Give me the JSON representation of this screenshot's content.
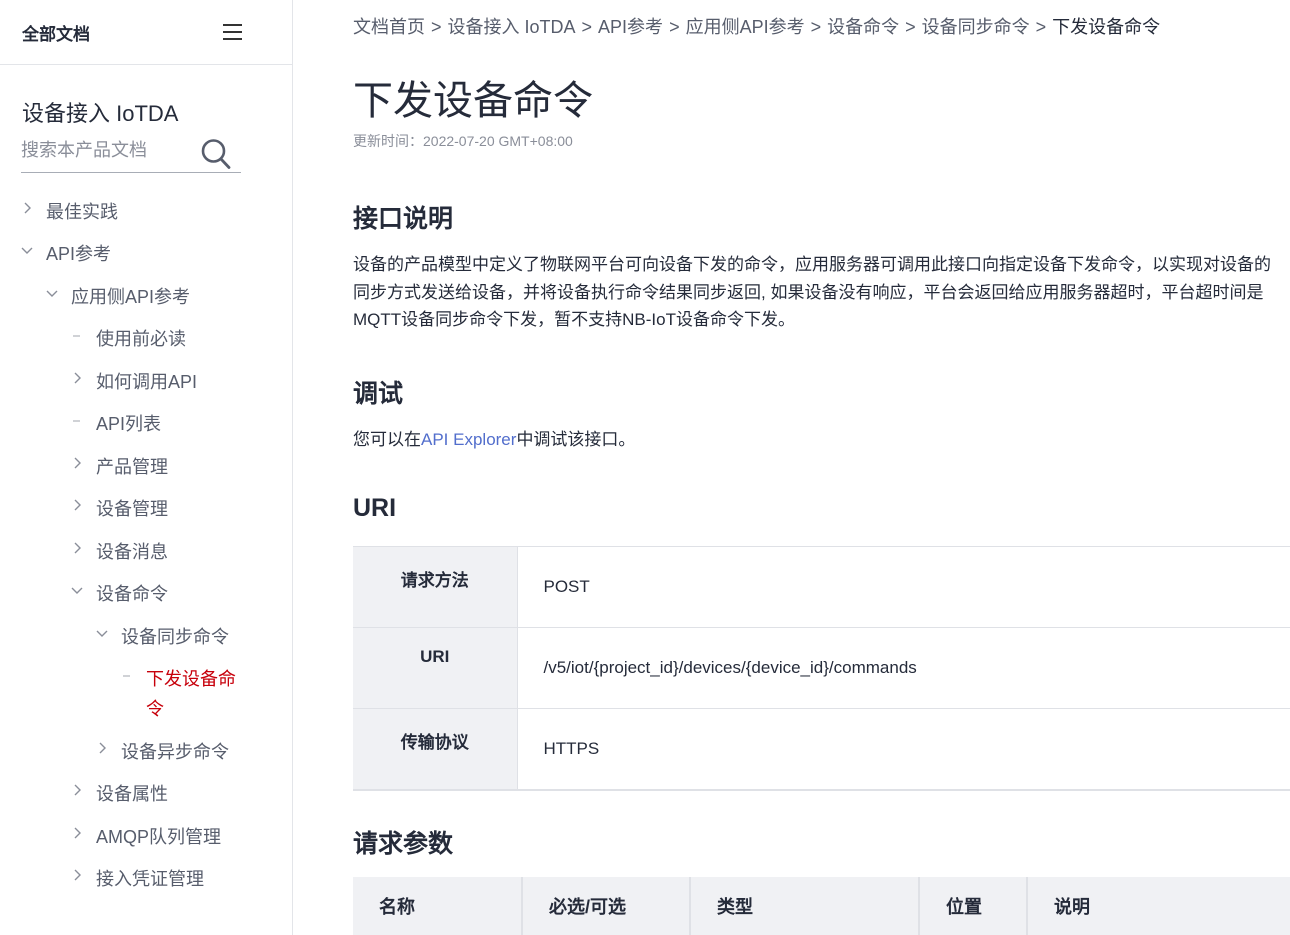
{
  "sidebar": {
    "all_docs": "全部文档",
    "product_title": "设备接入 IoTDA",
    "search_placeholder": "搜索本产品文档",
    "items": [
      {
        "label": "最佳实践",
        "marker": "chevron-right"
      },
      {
        "label": "API参考",
        "marker": "chevron-down"
      },
      {
        "label": "应用侧API参考",
        "marker": "chevron-down"
      },
      {
        "label": "使用前必读",
        "marker": "dash"
      },
      {
        "label": "如何调用API",
        "marker": "chevron-right"
      },
      {
        "label": "API列表",
        "marker": "dash"
      },
      {
        "label": "产品管理",
        "marker": "chevron-right"
      },
      {
        "label": "设备管理",
        "marker": "chevron-right"
      },
      {
        "label": "设备消息",
        "marker": "chevron-right"
      },
      {
        "label": "设备命令",
        "marker": "chevron-down"
      },
      {
        "label": "设备同步命令",
        "marker": "chevron-down"
      },
      {
        "label": "下发设备命",
        "label_line2": "令",
        "marker": "dash",
        "active": true
      },
      {
        "label": "设备异步命令",
        "marker": "chevron-right"
      },
      {
        "label": "设备属性",
        "marker": "chevron-right"
      },
      {
        "label": "AMQP队列管理",
        "marker": "chevron-right"
      },
      {
        "label": "接入凭证管理",
        "marker": "chevron-right"
      }
    ],
    "active_color": "#c7000b"
  },
  "breadcrumb": {
    "items": [
      "文档首页",
      "设备接入 IoTDA",
      "API参考",
      "应用侧API参考",
      "设备命令",
      "设备同步命令"
    ],
    "current": "下发设备命令",
    "separator": ">"
  },
  "page": {
    "title": "下发设备命令",
    "updated": "更新时间：2022-07-20 GMT+08:00"
  },
  "sections": {
    "interface": {
      "heading": "接口说明",
      "lines": [
        "设备的产品模型中定义了物联网平台可向设备下发的命令，应用服务器可调用此接口向指定设备下发命令，以实现对设备的",
        "同步方式发送给设备，并将设备执行命令结果同步返回, 如果设备没有响应，平台会返回给应用服务器超时，平台超时间是",
        "MQTT设备同步命令下发，暂不支持NB-IoT设备命令下发。"
      ]
    },
    "debug": {
      "heading": "调试",
      "prefix": "您可以在",
      "link": "API Explorer",
      "suffix": "中调试该接口。",
      "link_color": "#526ecc"
    },
    "uri": {
      "heading": "URI",
      "rows": [
        {
          "key": "请求方法",
          "value": "POST"
        },
        {
          "key": "URI",
          "value": "/v5/iot/{project_id}/devices/{device_id}/commands"
        },
        {
          "key": "传输协议",
          "value": "HTTPS"
        }
      ]
    },
    "params": {
      "heading": "请求参数",
      "columns": [
        "名称",
        "必选/可选",
        "类型",
        "位置",
        "说明"
      ]
    }
  }
}
